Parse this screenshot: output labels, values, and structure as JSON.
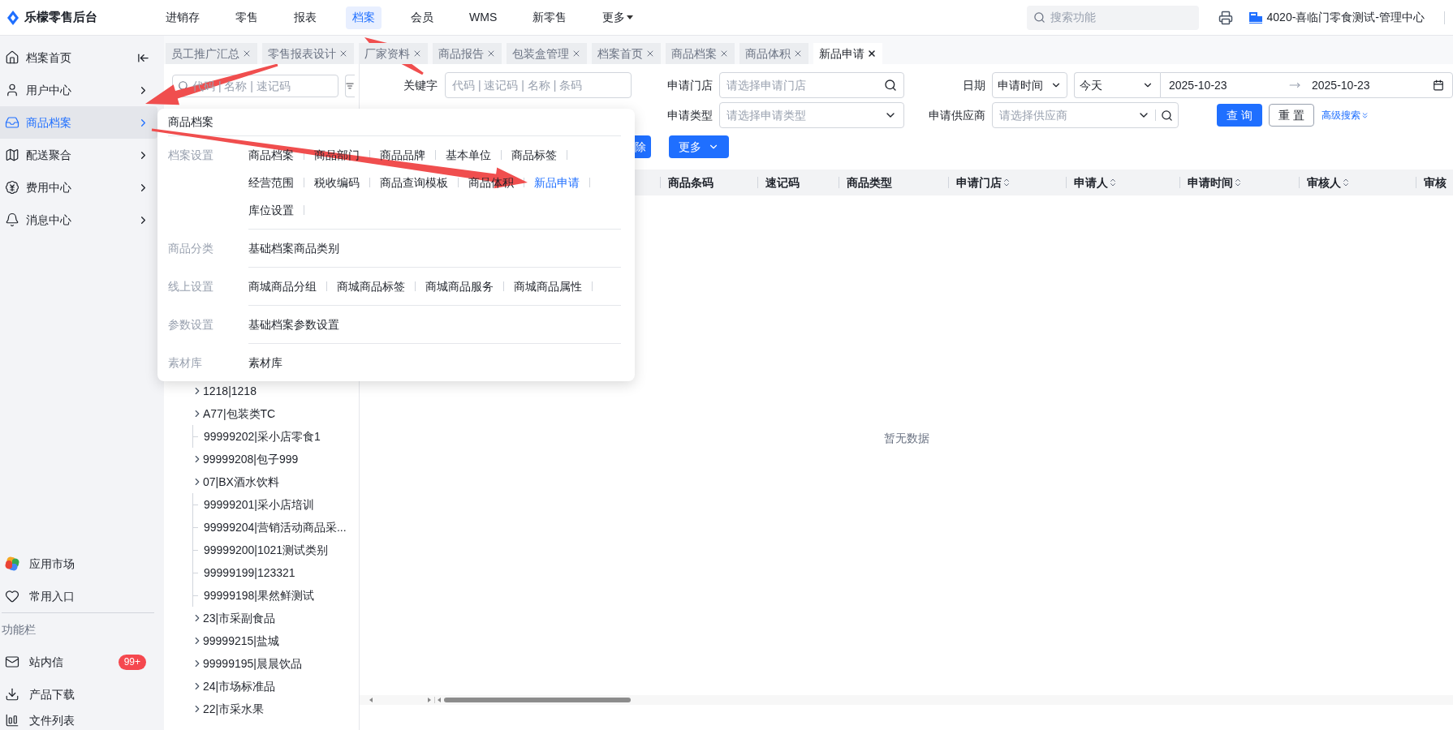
{
  "app": {
    "name": "乐檬零售后台"
  },
  "top_nav": [
    {
      "label": "进销存",
      "selected": false,
      "dropdown": false
    },
    {
      "label": "零售",
      "selected": false,
      "dropdown": false
    },
    {
      "label": "报表",
      "selected": false,
      "dropdown": false
    },
    {
      "label": "档案",
      "selected": true,
      "dropdown": false
    },
    {
      "label": "会员",
      "selected": false,
      "dropdown": false
    },
    {
      "label": "WMS",
      "selected": false,
      "dropdown": false
    },
    {
      "label": "新零售",
      "selected": false,
      "dropdown": false
    },
    {
      "label": "更多",
      "selected": false,
      "dropdown": true
    }
  ],
  "search": {
    "placeholder": "搜索功能"
  },
  "store": {
    "label": "4020-喜临门零食测试-管理中心"
  },
  "sidebar": {
    "items": [
      {
        "label": "档案首页",
        "kind": "home",
        "selected": false
      },
      {
        "label": "用户中心",
        "kind": "user",
        "selected": false
      },
      {
        "label": "商品档案",
        "kind": "goods",
        "selected": true
      },
      {
        "label": "配送聚合",
        "kind": "delivery",
        "selected": false
      },
      {
        "label": "费用中心",
        "kind": "fee",
        "selected": false
      },
      {
        "label": "消息中心",
        "kind": "message",
        "selected": false
      }
    ],
    "bottom_items": [
      {
        "label": "应用市场",
        "kind": "market"
      },
      {
        "label": "常用入口",
        "kind": "favorite"
      }
    ],
    "function_bar": {
      "title": "功能栏",
      "items": [
        {
          "label": "站内信",
          "kind": "mail",
          "badge": "99+"
        },
        {
          "label": "产品下载",
          "kind": "download"
        },
        {
          "label": "文件列表",
          "kind": "files"
        }
      ]
    }
  },
  "tabs": [
    {
      "label": "员工推广汇总",
      "selected": false
    },
    {
      "label": "零售报表设计",
      "selected": false
    },
    {
      "label": "厂家资料",
      "selected": false
    },
    {
      "label": "商品报告",
      "selected": false
    },
    {
      "label": "包装盒管理",
      "selected": false
    },
    {
      "label": "档案首页",
      "selected": false
    },
    {
      "label": "商品档案",
      "selected": false
    },
    {
      "label": "商品体积",
      "selected": false
    },
    {
      "label": "新品申请",
      "selected": true
    }
  ],
  "tree": {
    "search_placeholder": "代码 | 名称 | 速记码",
    "items": [
      {
        "label": "1218|1218",
        "kind": "folder"
      },
      {
        "label": "A77|包装类TC",
        "kind": "folder"
      },
      {
        "label": "99999202|采小店零食1",
        "kind": "leaf"
      },
      {
        "label": "99999208|包子999",
        "kind": "folder"
      },
      {
        "label": "07|BX酒水饮料",
        "kind": "folder"
      },
      {
        "label": "99999201|采小店培训",
        "kind": "leaf"
      },
      {
        "label": "99999204|营销活动商品采...",
        "kind": "leaf"
      },
      {
        "label": "99999200|1021测试类别",
        "kind": "leaf"
      },
      {
        "label": "99999199|123321",
        "kind": "leaf"
      },
      {
        "label": "99999198|果然鲜测试",
        "kind": "leaf"
      },
      {
        "label": "23|市采副食品",
        "kind": "folder"
      },
      {
        "label": "99999215|盐城",
        "kind": "folder"
      },
      {
        "label": "99999195|晨晨饮品",
        "kind": "folder"
      },
      {
        "label": "24|市场标准品",
        "kind": "folder"
      },
      {
        "label": "22|市采水果",
        "kind": "folder"
      }
    ]
  },
  "filters": {
    "keyword": {
      "label": "关键字",
      "placeholder": "代码 | 速记码 | 名称 | 条码"
    },
    "store": {
      "label": "申请门店",
      "placeholder": "请选择申请门店"
    },
    "date": {
      "label": "日期",
      "type": "申请时间",
      "preset": "今天",
      "start": "2025-10-23",
      "end": "2025-10-23"
    },
    "apply_type": {
      "label": "申请类型",
      "placeholder": "请选择申请类型"
    },
    "supplier": {
      "label": "申请供应商",
      "placeholder": "请选择供应商"
    },
    "buttons": [
      {
        "label": "查询",
        "kind": "primary"
      },
      {
        "label": "重置",
        "kind": "default"
      }
    ],
    "advanced": "高级搜索"
  },
  "actions": [
    {
      "label": "除",
      "kind": "primary"
    },
    {
      "label": "更多",
      "kind": "dropdown"
    }
  ],
  "table": {
    "columns": [
      {
        "label": "商品条码",
        "sortable": false
      },
      {
        "label": "速记码",
        "sortable": false
      },
      {
        "label": "商品类型",
        "sortable": false
      },
      {
        "label": "申请门店",
        "sortable": true
      },
      {
        "label": "申请人",
        "sortable": true
      },
      {
        "label": "申请时间",
        "sortable": true
      },
      {
        "label": "审核人",
        "sortable": true
      },
      {
        "label": "审核",
        "sortable": false
      }
    ],
    "empty_text": "暂无数据"
  },
  "menu": {
    "title": "商品档案",
    "sections": [
      {
        "label": "档案设置",
        "items": [
          {
            "label": "商品档案",
            "selected": false
          },
          {
            "label": "商品部门",
            "selected": false
          },
          {
            "label": "商品品牌",
            "selected": false
          },
          {
            "label": "基本单位",
            "selected": false
          },
          {
            "label": "商品标签",
            "selected": false
          },
          {
            "label": "经营范围",
            "selected": false
          },
          {
            "label": "税收编码",
            "selected": false
          },
          {
            "label": "商品查询模板",
            "selected": false
          },
          {
            "label": "商品体积",
            "selected": false
          },
          {
            "label": "新品申请",
            "selected": true
          },
          {
            "label": "库位设置",
            "selected": false
          }
        ]
      },
      {
        "label": "商品分类",
        "items": [
          {
            "label": "基础档案商品类别",
            "selected": false
          }
        ]
      },
      {
        "label": "线上设置",
        "items": [
          {
            "label": "商城商品分组",
            "selected": false
          },
          {
            "label": "商城商品标签",
            "selected": false
          },
          {
            "label": "商城商品服务",
            "selected": false
          },
          {
            "label": "商城商品属性",
            "selected": false
          }
        ]
      },
      {
        "label": "参数设置",
        "items": [
          {
            "label": "基础档案参数设置",
            "selected": false
          }
        ]
      },
      {
        "label": "素材库",
        "items": [
          {
            "label": "素材库",
            "selected": false
          }
        ]
      }
    ]
  }
}
